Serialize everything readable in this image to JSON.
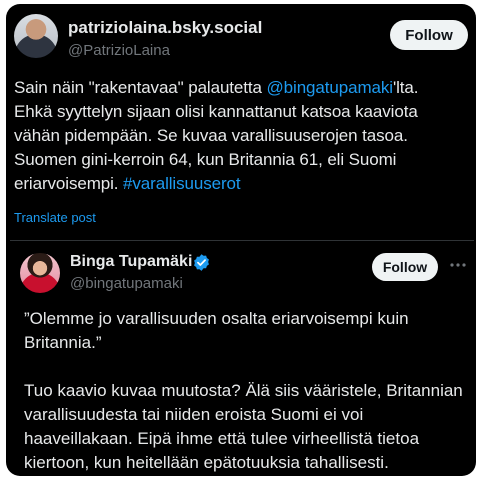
{
  "post": {
    "display_name": "patriziolaina.bsky.social",
    "handle": "@PatrizioLaina",
    "follow_label": "Follow",
    "text_lines": [
      [
        "Sain näin \"rakentavaa\" palautetta ",
        "@bingatupamaki",
        "'lta."
      ],
      "Ehkä syyttelyn sijaan olisi kannattanut katsoa kaaviota",
      "vähän pidempään. Se kuvaa varallisuuserojen tasoa.",
      "Suomen gini-kerroin 64, kun Britannia 61, eli Suomi",
      [
        "eriarvoisempi.  ",
        "#varallisuuserot"
      ]
    ],
    "translate_label": "Translate post"
  },
  "quote": {
    "display_name": "Binga Tupamäki",
    "handle": "@bingatupamaki",
    "follow_label": "Follow",
    "paragraph1": [
      "”Olemme jo varallisuuden osalta eriarvoisempi kuin",
      "Britannia.”"
    ],
    "paragraph2": [
      "Tuo kaavio kuvaa muutosta? Älä siis vääristele, Britannian",
      "varallisuudesta tai niiden eroista Suomi ei voi",
      "haaveillakaan. Eipä ihme että tulee virheellistä tietoa",
      "kiertoon, kun heitellään epätotuuksia tahallisesti."
    ]
  },
  "icons": {
    "verified": "verified-badge-icon",
    "more": "more-options-icon"
  },
  "colors": {
    "background": "#000000",
    "text": "#e7e9ea",
    "muted": "#71767b",
    "link": "#1d9bf0",
    "follow_bg": "#eff3f4"
  }
}
